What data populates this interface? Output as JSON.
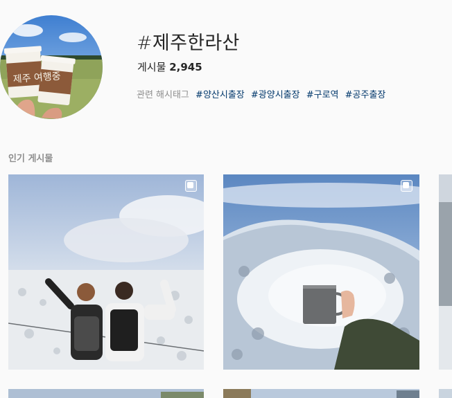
{
  "hashtag": {
    "title": "#제주한라산",
    "posts_label": "게시물",
    "posts_count": "2,945",
    "related_label": "관련 해시태그",
    "related_tags": [
      "#양산시출장",
      "#광양시출장",
      "#구로역",
      "#공주출장"
    ]
  },
  "avatar_text": "제주 여행중",
  "top_posts_label": "인기 게시물",
  "icons": {
    "multi_photo": "carousel-icon"
  }
}
